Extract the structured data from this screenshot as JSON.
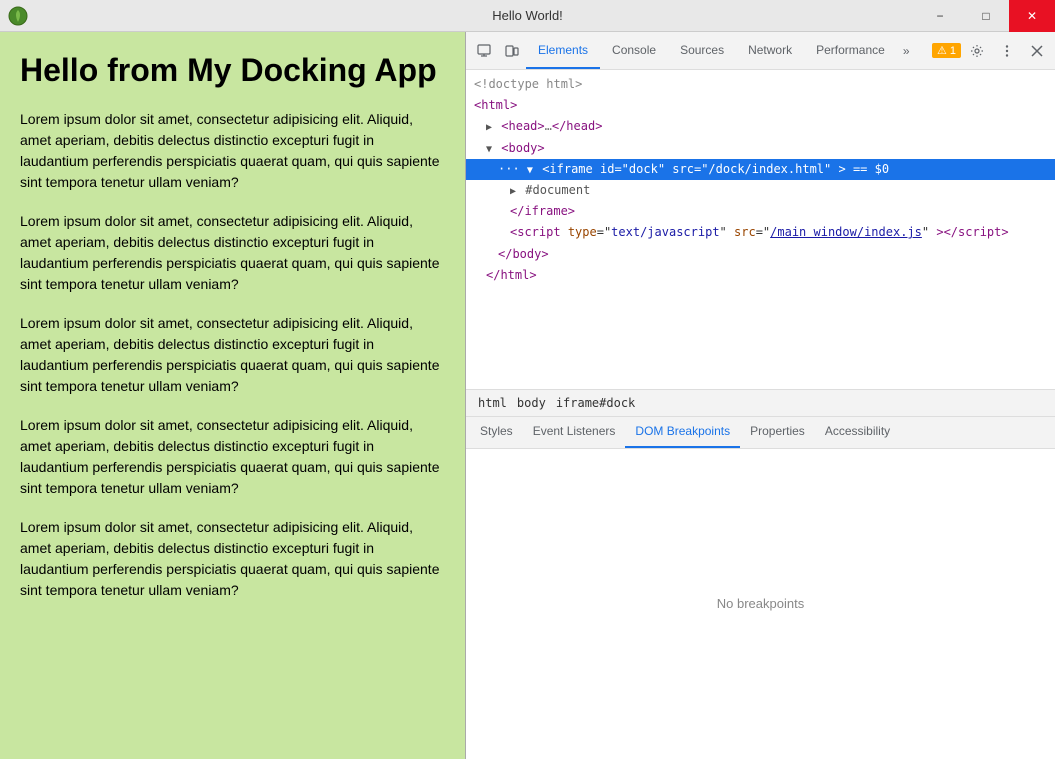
{
  "titleBar": {
    "title": "Hello World!",
    "minimizeLabel": "−",
    "maximizeLabel": "□",
    "closeLabel": "✕"
  },
  "content": {
    "heading": "Hello from My Docking App",
    "paragraphs": [
      "Lorem ipsum dolor sit amet, consectetur adipisicing elit. Aliquid, amet aperiam, debitis delectus distinctio excepturi fugit in laudantium perferendis perspiciatis quaerat quam, qui quis sapiente sint tempora tenetur ullam veniam?",
      "Lorem ipsum dolor sit amet, consectetur adipisicing elit. Aliquid, amet aperiam, debitis delectus distinctio excepturi fugit in laudantium perferendis perspiciatis quaerat quam, qui quis sapiente sint tempora tenetur ullam veniam?",
      "Lorem ipsum dolor sit amet, consectetur adipisicing elit. Aliquid, amet aperiam, debitis delectus distinctio excepturi fugit in laudantium perferendis perspiciatis quaerat quam, qui quis sapiente sint tempora tenetur ullam veniam?",
      "Lorem ipsum dolor sit amet, consectetur adipisicing elit. Aliquid, amet aperiam, debitis delectus distinctio excepturi fugit in laudantium perferendis perspiciatis quaerat quam, qui quis sapiente sint tempora tenetur ullam veniam?",
      "Lorem ipsum dolor sit amet, consectetur adipisicing elit. Aliquid, amet aperiam, debitis delectus distinctio excepturi fugit in laudantium perferendis perspiciatis quaerat quam, qui quis sapiente sint tempora tenetur ullam veniam?"
    ]
  },
  "devtools": {
    "tabs": [
      {
        "id": "elements",
        "label": "Elements",
        "active": true
      },
      {
        "id": "console",
        "label": "Console",
        "active": false
      },
      {
        "id": "sources",
        "label": "Sources",
        "active": false
      },
      {
        "id": "network",
        "label": "Network",
        "active": false
      },
      {
        "id": "performance",
        "label": "Performance",
        "active": false
      }
    ],
    "moreTabsLabel": "»",
    "warningCount": "1",
    "dom": {
      "lines": [
        {
          "indent": 0,
          "content": "<!doctype html>",
          "type": "comment"
        },
        {
          "indent": 0,
          "content": "<html>",
          "type": "tag"
        },
        {
          "indent": 1,
          "content": "▶ <head>…</head>",
          "type": "collapsed"
        },
        {
          "indent": 1,
          "content": "▼ <body>",
          "type": "open"
        },
        {
          "indent": 2,
          "content_selected": true,
          "tagOpen": "<iframe",
          "attrs": "id=\"dock\" src=\"/dock/index.html\"",
          "extra": " == $0",
          "type": "selected"
        },
        {
          "indent": 3,
          "content": "▶ #document",
          "type": "collapsed"
        },
        {
          "indent": 3,
          "content": "</iframe>",
          "type": "close"
        },
        {
          "indent": 3,
          "content_script": true,
          "type": "script"
        },
        {
          "indent": 2,
          "content": "</body>",
          "type": "close"
        },
        {
          "indent": 1,
          "content": "</html>",
          "type": "close"
        }
      ]
    },
    "breadcrumbs": [
      "html",
      "body",
      "iframe#dock"
    ],
    "bottomTabs": [
      {
        "id": "styles",
        "label": "Styles",
        "active": false
      },
      {
        "id": "event-listeners",
        "label": "Event Listeners",
        "active": false
      },
      {
        "id": "dom-breakpoints",
        "label": "DOM Breakpoints",
        "active": true
      },
      {
        "id": "properties",
        "label": "Properties",
        "active": false
      },
      {
        "id": "accessibility",
        "label": "Accessibility",
        "active": false
      }
    ],
    "noBreakpointsText": "No breakpoints"
  }
}
